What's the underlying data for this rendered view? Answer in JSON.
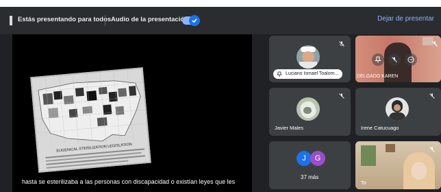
{
  "banner": {
    "presenting_text": "Estás presentando para todos",
    "audio_label": "Audio de la presentación",
    "audio_enabled": true,
    "stop_label": "Dejar de presentar"
  },
  "presentation": {
    "map_title": "EUGENICAL STERILIZATION LEGISLATION",
    "caption": "hasta se esterilizaba a las personas con discapacidad o existían leyes que les"
  },
  "participants": [
    {
      "name": "Luciano Ismael Toalom...",
      "muted": true,
      "pinned_label": true
    },
    {
      "name": "DELGADO KAREN",
      "muted": true
    },
    {
      "name": "Javier Males",
      "muted": true
    },
    {
      "name": "Irene Catucuago",
      "muted": true
    },
    {
      "name": "37 más",
      "initials": [
        "J",
        "G"
      ]
    },
    {
      "name": "To",
      "muted": true
    }
  ],
  "colors": {
    "accent": "#8ab4f8",
    "toggle": "#1a73e8",
    "tile_bg": "#3c4043",
    "avatar_j": "#1a73e8",
    "avatar_g": "#9c4dcc"
  }
}
